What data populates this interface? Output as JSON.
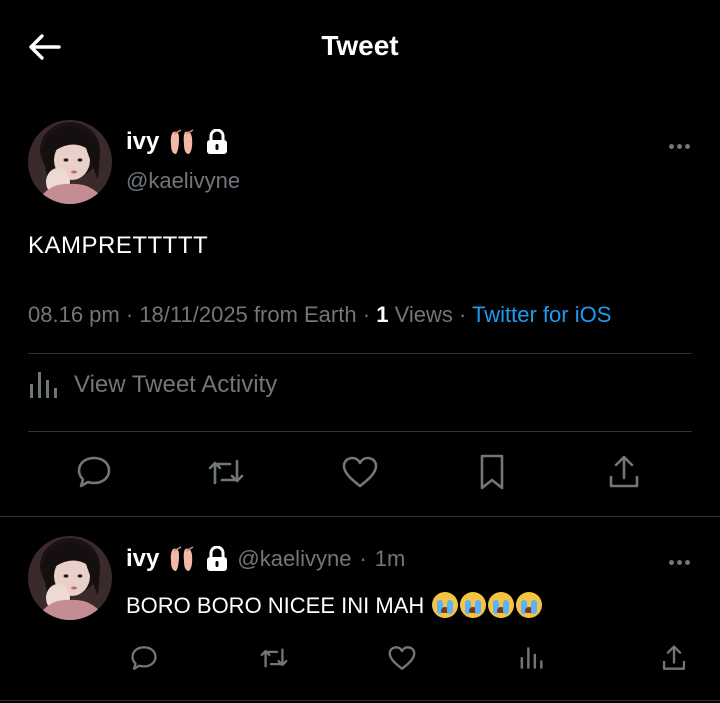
{
  "header": {
    "title": "Tweet",
    "back_icon": "arrow-left-icon"
  },
  "tweet": {
    "display_name": "ivy",
    "handle": "@kaelivyne",
    "text": "KAMPRETTTTT",
    "time": "08.16 pm",
    "date": "18/11/2025 from Earth",
    "views_count": "1",
    "views_label": "Views",
    "client": "Twitter for iOS",
    "activity_label": "View Tweet Activity",
    "badges": [
      "ballet-shoes-emoji",
      "lock-icon"
    ]
  },
  "reply": {
    "display_name": "ivy",
    "handle": "@kaelivyne",
    "time": "1m",
    "text": "BORO BORO NICEE INI MAH",
    "emoji_count": 4
  },
  "colors": {
    "background": "#000000",
    "text": "#ffffff",
    "muted": "#71767b",
    "link": "#1d9bf0",
    "divider": "#2f3336"
  }
}
